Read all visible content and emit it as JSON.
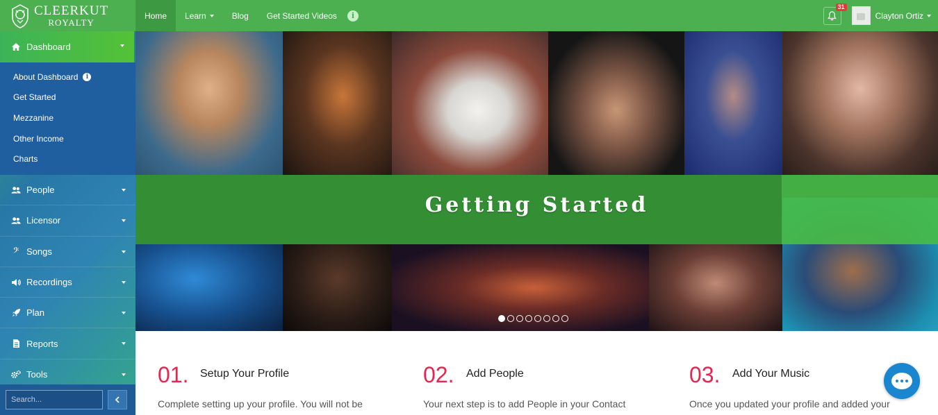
{
  "brand": {
    "line1": "CLEERKUT",
    "line2": "ROYALTY",
    "icon": "lion-crest-icon"
  },
  "nav": {
    "items": [
      {
        "label": "Home",
        "active": true
      },
      {
        "label": "Learn",
        "dropdown": true
      },
      {
        "label": "Blog"
      },
      {
        "label": "Get Started Videos"
      }
    ],
    "info_icon": "i"
  },
  "user": {
    "notification_count": "31",
    "name": "Clayton Ortiz"
  },
  "sidebar": {
    "dashboard": {
      "label": "Dashboard",
      "icon": "home-icon"
    },
    "dashboard_items": [
      {
        "label": "About Dashboard",
        "info": true
      },
      {
        "label": "Get Started"
      },
      {
        "label": "Mezzanine"
      },
      {
        "label": "Other Income"
      },
      {
        "label": "Charts"
      }
    ],
    "items": [
      {
        "label": "People",
        "icon": "users-icon"
      },
      {
        "label": "Licensor",
        "icon": "users-icon"
      },
      {
        "label": "Songs",
        "icon": "bass-clef-icon"
      },
      {
        "label": "Recordings",
        "icon": "volume-icon"
      },
      {
        "label": "Plan",
        "icon": "rocket-icon"
      },
      {
        "label": "Reports",
        "icon": "document-icon"
      },
      {
        "label": "Tools",
        "icon": "gears-icon"
      }
    ],
    "search_placeholder": "Search..."
  },
  "banner": {
    "title": "Getting Started",
    "slide_count": 8,
    "active_slide": 1
  },
  "steps": [
    {
      "number": "01.",
      "title": "Setup Your Profile",
      "text": "Complete setting up your profile. You will not be"
    },
    {
      "number": "02.",
      "title": "Add People",
      "text": "Your next step is to add People in your Contact"
    },
    {
      "number": "03.",
      "title": "Add Your Music",
      "text": "Once you updated your profile and added your"
    }
  ],
  "colors": {
    "brand_green": "#4caf50",
    "step_number": "#e8254e",
    "chat_blue": "#1a86cf"
  }
}
